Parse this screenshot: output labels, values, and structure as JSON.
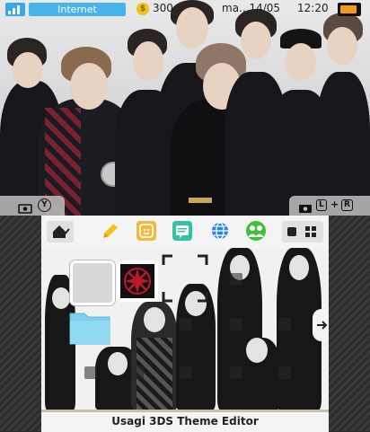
{
  "status_bar": {
    "connection": "Internet",
    "coins": "300",
    "coin_symbol": "$",
    "date": "ma., 14/05",
    "time": "12:20"
  },
  "top_controls": {
    "left_button": "Y",
    "right_l": "L",
    "right_plus": "+",
    "right_r": "R"
  },
  "footer": {
    "title": "Usagi 3DS Theme Editor"
  },
  "colors": {
    "accent_blue": "#46b4ea",
    "battery": "#f29b1a",
    "coin": "#f2c21a"
  },
  "toolbar_icons": [
    "home-settings-icon",
    "pencil-icon",
    "miiverse-face-icon",
    "notes-icon",
    "globe-icon",
    "friends-icon",
    "view-toggle-icon",
    "grid-icon"
  ]
}
